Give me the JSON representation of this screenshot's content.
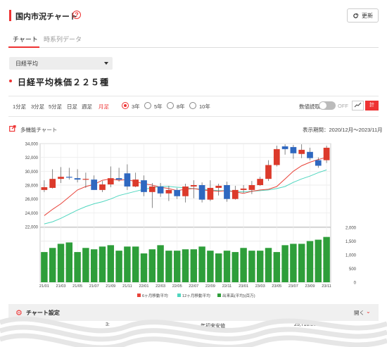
{
  "header": {
    "title": "国内市況チャート",
    "help": "?",
    "refresh_label": "更新"
  },
  "tabs": [
    {
      "label": "チャート",
      "active": true
    },
    {
      "label": "時系列データ",
      "active": false
    }
  ],
  "index_select": {
    "value": "日経平均"
  },
  "subtitle": "日経平均株価２２５種",
  "intervals": [
    {
      "label": "1分足"
    },
    {
      "label": "3分足"
    },
    {
      "label": "5分足"
    },
    {
      "label": "日足"
    },
    {
      "label": "週足"
    },
    {
      "label": "月足",
      "active": true
    }
  ],
  "ranges": [
    {
      "label": "3年",
      "active": true
    },
    {
      "label": "5年"
    },
    {
      "label": "8年"
    },
    {
      "label": "10年"
    }
  ],
  "value_display": {
    "label": "数値読取",
    "state": "OFF"
  },
  "view_buttons": {
    "line_icon": "line-chart-icon",
    "candle_label": "計"
  },
  "multi_chart_label": "多機能チャート",
  "period_label": "表示期間：2020/12月〜2023/11月",
  "settings": {
    "label": "チャート設定",
    "open_label": "開く"
  },
  "bottom_row": {
    "left_value": "3:",
    "right_label": "年初来安値",
    "right_value": "25,716.86"
  },
  "chart_data": {
    "type": "candlestick",
    "x_labels": [
      "21/01",
      "21/03",
      "21/05",
      "21/07",
      "21/09",
      "21/11",
      "22/01",
      "22/03",
      "22/05",
      "22/07",
      "22/09",
      "22/11",
      "23/01",
      "23/03",
      "23/05",
      "23/07",
      "23/09",
      "23/11"
    ],
    "price_ticks": [
      "34,000",
      "32,000",
      "30,000",
      "28,000",
      "26,000",
      "24,000",
      "22,000"
    ],
    "price_ylim": [
      22000,
      34000
    ],
    "volume_ticks": [
      "2,000",
      "1,500",
      "1,000",
      "500",
      "0"
    ],
    "volume_ylim": [
      0,
      2000
    ],
    "candles": [
      {
        "o": 27300,
        "c": 27700,
        "h": 28700,
        "l": 27000
      },
      {
        "o": 27600,
        "c": 28900,
        "h": 30300,
        "l": 27500
      },
      {
        "o": 28900,
        "c": 29200,
        "h": 30600,
        "l": 28300
      },
      {
        "o": 29200,
        "c": 29100,
        "h": 30500,
        "l": 28800
      },
      {
        "o": 29000,
        "c": 28800,
        "h": 30300,
        "l": 28400
      },
      {
        "o": 28800,
        "c": 28900,
        "h": 29800,
        "l": 27600
      },
      {
        "o": 28800,
        "c": 27300,
        "h": 29400,
        "l": 27300
      },
      {
        "o": 27300,
        "c": 28100,
        "h": 28600,
        "l": 27000
      },
      {
        "o": 28100,
        "c": 29000,
        "h": 30700,
        "l": 27700
      },
      {
        "o": 29000,
        "c": 28800,
        "h": 30500,
        "l": 28500
      },
      {
        "o": 29700,
        "c": 27800,
        "h": 31000,
        "l": 27300
      },
      {
        "o": 27800,
        "c": 28800,
        "h": 29800,
        "l": 27700
      },
      {
        "o": 28700,
        "c": 27000,
        "h": 29400,
        "l": 26400
      },
      {
        "o": 27000,
        "c": 27800,
        "h": 28300,
        "l": 24700
      },
      {
        "o": 27800,
        "c": 26800,
        "h": 28300,
        "l": 26300
      },
      {
        "o": 26800,
        "c": 27300,
        "h": 27900,
        "l": 25700
      },
      {
        "o": 27300,
        "c": 26400,
        "h": 27600,
        "l": 26000
      },
      {
        "o": 26400,
        "c": 27800,
        "h": 28200,
        "l": 25500
      },
      {
        "o": 27800,
        "c": 28000,
        "h": 28700,
        "l": 26100
      },
      {
        "o": 28000,
        "c": 25900,
        "h": 28400,
        "l": 25500
      },
      {
        "o": 25900,
        "c": 27600,
        "h": 28700,
        "l": 25700
      },
      {
        "o": 27600,
        "c": 27900,
        "h": 28200,
        "l": 26500
      },
      {
        "o": 28000,
        "c": 26000,
        "h": 28500,
        "l": 25600
      },
      {
        "o": 26000,
        "c": 27300,
        "h": 27900,
        "l": 25900
      },
      {
        "o": 27300,
        "c": 27500,
        "h": 28000,
        "l": 26900
      },
      {
        "o": 27300,
        "c": 28000,
        "h": 28600,
        "l": 26700
      },
      {
        "o": 28000,
        "c": 28900,
        "h": 29200,
        "l": 27900
      },
      {
        "o": 28900,
        "c": 30900,
        "h": 31600,
        "l": 28600
      },
      {
        "o": 30900,
        "c": 33200,
        "h": 33700,
        "l": 30700
      },
      {
        "o": 33600,
        "c": 33200,
        "h": 33900,
        "l": 32400
      },
      {
        "o": 33500,
        "c": 32600,
        "h": 33800,
        "l": 31800
      },
      {
        "o": 32500,
        "c": 33100,
        "h": 33900,
        "l": 31900
      },
      {
        "o": 32800,
        "c": 31900,
        "h": 33400,
        "l": 31600
      },
      {
        "o": 31600,
        "c": 30800,
        "h": 32000,
        "l": 30500
      },
      {
        "o": 31600,
        "c": 33400,
        "h": 33700,
        "l": 31200
      }
    ],
    "ma6": [
      23600,
      24500,
      25300,
      26300,
      27300,
      27800,
      28100,
      28700,
      28900,
      28700,
      28800,
      28500,
      28200,
      28000,
      27700,
      27500,
      27200,
      27400,
      27500,
      27300,
      27200,
      27100,
      27200,
      27000,
      26800,
      27100,
      27300,
      27400,
      27800,
      28900,
      30000,
      30800,
      31300,
      31700,
      32000
    ],
    "ma12": [
      22400,
      22700,
      23200,
      23800,
      24400,
      24900,
      25300,
      25600,
      26000,
      26500,
      26800,
      27100,
      27400,
      27600,
      27800,
      27800,
      27700,
      27600,
      27500,
      27400,
      27300,
      27200,
      27200,
      27100,
      27000,
      27100,
      27200,
      27300,
      27500,
      27800,
      28400,
      28900,
      29300,
      29800,
      30200
    ],
    "volume": [
      1100,
      1250,
      1400,
      1450,
      1100,
      1250,
      1200,
      1300,
      1350,
      1150,
      1300,
      1300,
      1050,
      1200,
      1350,
      1150,
      1150,
      1200,
      1200,
      1300,
      1150,
      1050,
      1150,
      1100,
      1250,
      1150,
      1150,
      1250,
      1100,
      1350,
      1400,
      1400,
      1500,
      1550,
      1650
    ],
    "legend": [
      "6ヶ月移動平均",
      "12ヶ月移動平均",
      "出来高(平均)(百万)"
    ],
    "colors": {
      "up": "#dc3a2b",
      "down": "#2f68c0",
      "ma6": "#e8433a",
      "ma12": "#4fd6bf",
      "volume": "#2e9e3a"
    }
  }
}
